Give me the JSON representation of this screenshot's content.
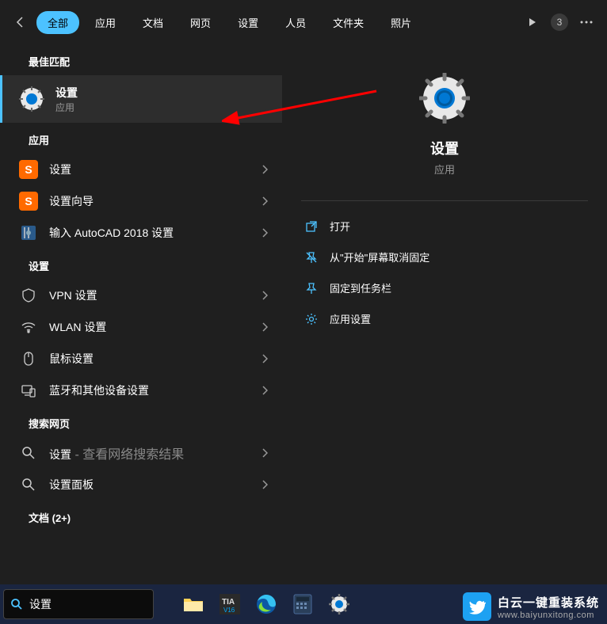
{
  "header": {
    "tabs": [
      "全部",
      "应用",
      "文档",
      "网页",
      "设置",
      "人员",
      "文件夹",
      "照片"
    ],
    "active_tab_index": 0,
    "badge_count": "3"
  },
  "left": {
    "best_match_header": "最佳匹配",
    "best_match": {
      "title": "设置",
      "subtitle": "应用"
    },
    "apps_header": "应用",
    "apps": [
      {
        "title": "设置",
        "icon": "sogou"
      },
      {
        "title": "设置向导",
        "icon": "sogou"
      },
      {
        "title": "输入 AutoCAD 2018 设置",
        "icon": "autocad"
      }
    ],
    "settings_header": "设置",
    "settings": [
      {
        "title": "VPN 设置",
        "icon": "shield"
      },
      {
        "title": "WLAN 设置",
        "icon": "wifi"
      },
      {
        "title": "鼠标设置",
        "icon": "mouse"
      },
      {
        "title": "蓝牙和其他设备设置",
        "icon": "devices"
      }
    ],
    "web_header": "搜索网页",
    "web": [
      {
        "title": "设置",
        "subtitle": " - 查看网络搜索结果"
      },
      {
        "title": "设置面板",
        "subtitle": ""
      }
    ],
    "docs_header": "文档 (2+)"
  },
  "right": {
    "hero_title": "设置",
    "hero_subtitle": "应用",
    "actions": [
      {
        "label": "打开",
        "icon": "open"
      },
      {
        "label": "从\"开始\"屏幕取消固定",
        "icon": "unpin"
      },
      {
        "label": "固定到任务栏",
        "icon": "pin"
      },
      {
        "label": "应用设置",
        "icon": "gear"
      }
    ]
  },
  "taskbar": {
    "search_value": "设置"
  },
  "watermark": {
    "title": "白云一键重装系统",
    "url": "www.baiyunxitong.com"
  }
}
